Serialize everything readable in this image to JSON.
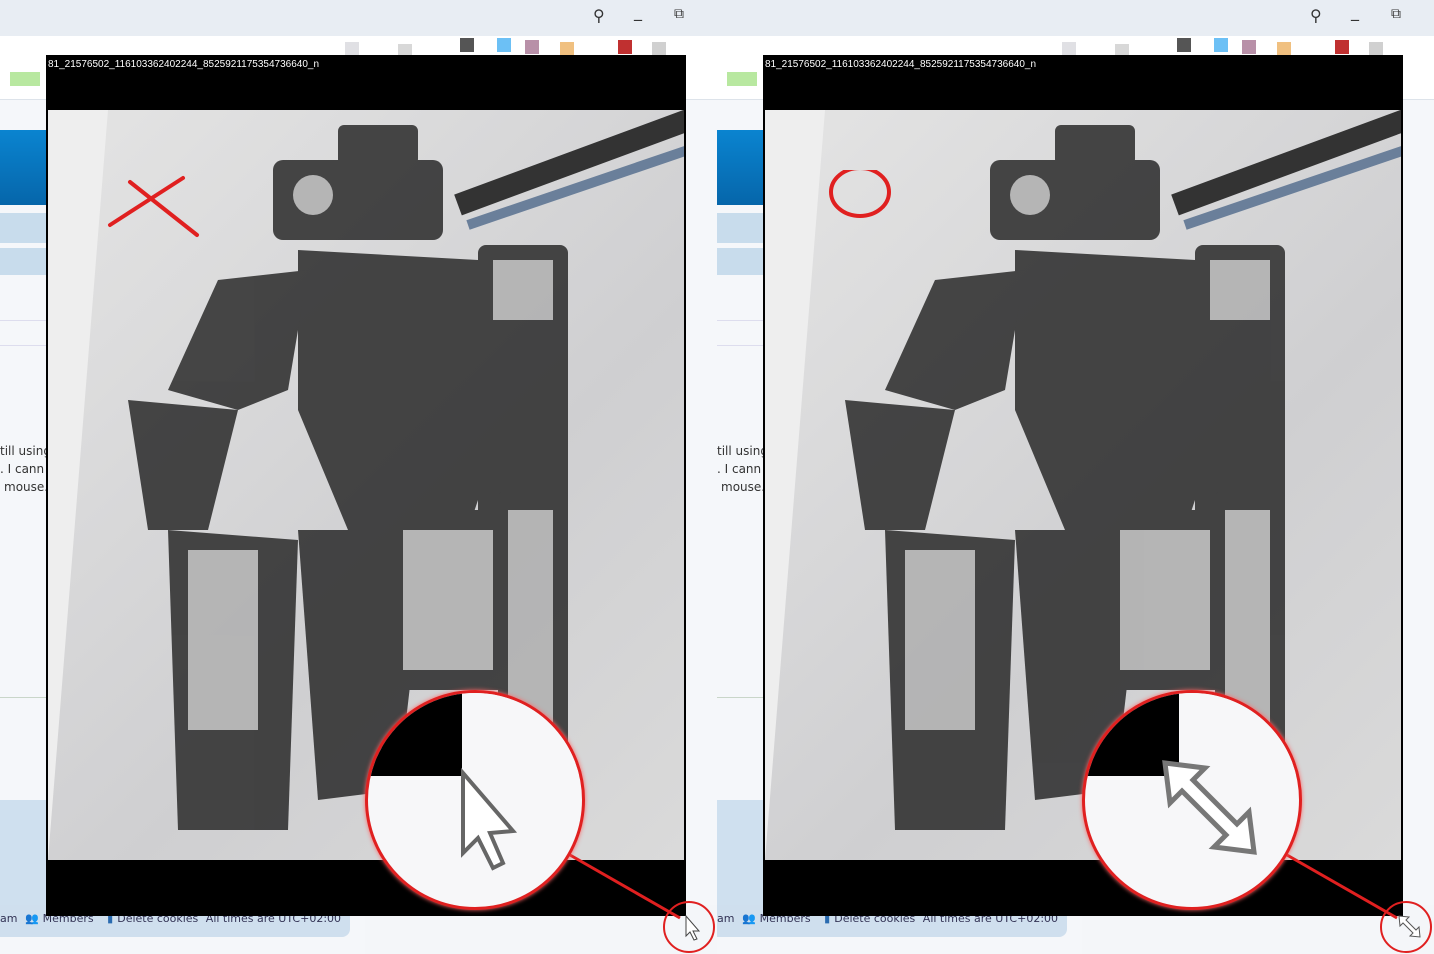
{
  "panels": [
    {
      "id": "left",
      "mark": "cross",
      "cursor": "arrow-pointer"
    },
    {
      "id": "right",
      "mark": "circle",
      "cursor": "diagonal-resize"
    }
  ],
  "viewer": {
    "title": "81_21576502_116103362402244_8525921175354736640_n"
  },
  "background_page": {
    "text_lines": [
      "till using",
      ". I cann",
      "mouse."
    ],
    "footer": {
      "team": "am",
      "members": "Members",
      "delete_cookies": "Delete cookies",
      "timezone": "All times are UTC+02:00"
    }
  },
  "colors": {
    "annotation": "#e02020",
    "forum_header": "#0a75c0"
  }
}
